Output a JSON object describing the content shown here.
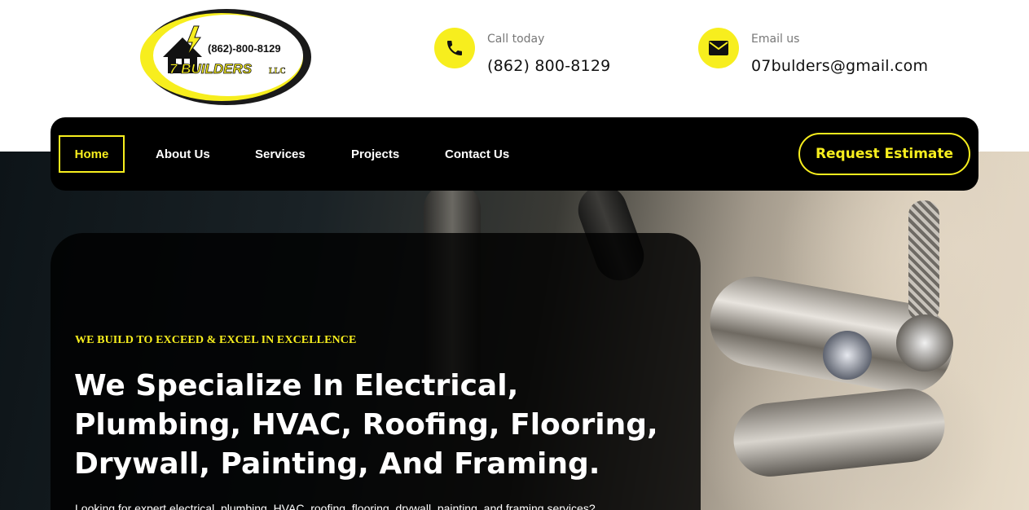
{
  "logo": {
    "phone": "(862)-800-8129",
    "brand": "7 BUILDERS",
    "suffix": "LLC"
  },
  "contact": {
    "call_label": "Call today",
    "call_value": "(862) 800-8129",
    "email_label": "Email us",
    "email_value": "07bulders@gmail.com"
  },
  "nav": {
    "items": [
      {
        "label": "Home",
        "active": true
      },
      {
        "label": "About Us"
      },
      {
        "label": "Services"
      },
      {
        "label": "Projects"
      },
      {
        "label": "Contact Us"
      }
    ],
    "cta_label": "Request Estimate"
  },
  "hero": {
    "tagline": "WE BUILD TO EXCEED & EXCEL IN EXCELLENCE",
    "headline": "We Specialize In Electrical, Plumbing, HVAC, Roofing, Flooring, Drywall, Painting, And Framing.",
    "description": "Looking for expert electrical, plumbing, HVAC, roofing, flooring, drywall, painting, and framing services?"
  },
  "colors": {
    "accent": "#f7ee1e",
    "dark": "#000000",
    "text": "#111111"
  },
  "icons": {
    "call": "phone-icon",
    "email": "envelope-icon"
  }
}
